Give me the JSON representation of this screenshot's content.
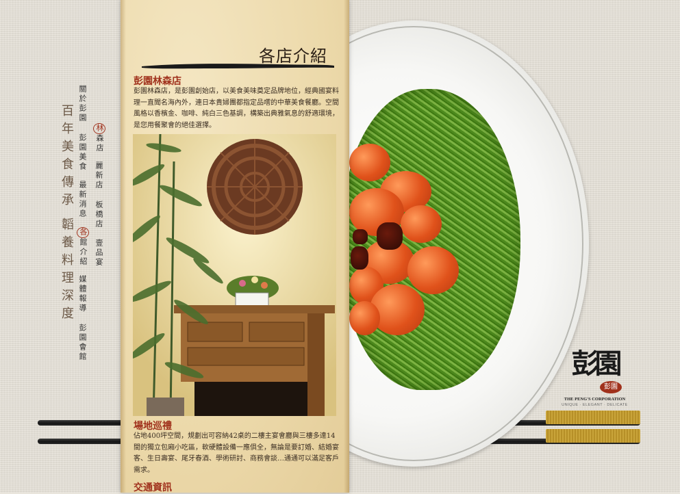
{
  "page": {
    "title": "各店介紹",
    "slogan": [
      "百年美食傳承",
      "韜養料理深度"
    ]
  },
  "nav": {
    "col1": [
      "關於彭園",
      "彭園美食",
      "最新消息",
      "各館介紹",
      "媒體報導",
      "彭園會館"
    ],
    "col2": [
      "林森店",
      "麗新店",
      "板橋店",
      "壹品宴"
    ],
    "col1_active_index": 3,
    "col2_active_index": 0
  },
  "content": {
    "store_name": "彭園林森店",
    "store_desc": "彭園林森店，是彭園創始店，以美食美味奠定品牌地位，經典國宴料理一直聞名海內外，連日本貴婦團都指定品嚐的中華美食餐廳。空間風格以香檳金、咖啡、純白三色基調，構築出典雅氣息的舒適環境，是您用餐聚會的絕佳選擇。",
    "venue_title": "場地巡禮",
    "venue_desc": "佔地400坪空間，規劃出可容納42桌的二樓主宴會廳與三樓多達14間的獨立包廂小吃區，軟硬體設備一應俱全，無論是要訂婚、結婚宴客、生日壽宴、尾牙春酒、學術研討、商務會談…通通可以滿足客戶需求。",
    "transport_title": "交通資訊"
  },
  "logo": {
    "mark": "彭園",
    "seal": "彭園",
    "corp": "THE PENG'S CORPORATION",
    "tagline": "UNIQUE · ELEGANT · DELICATE"
  },
  "colors": {
    "accent": "#a0311c",
    "paper": "#ecd9aa",
    "background": "#e8e4db"
  }
}
